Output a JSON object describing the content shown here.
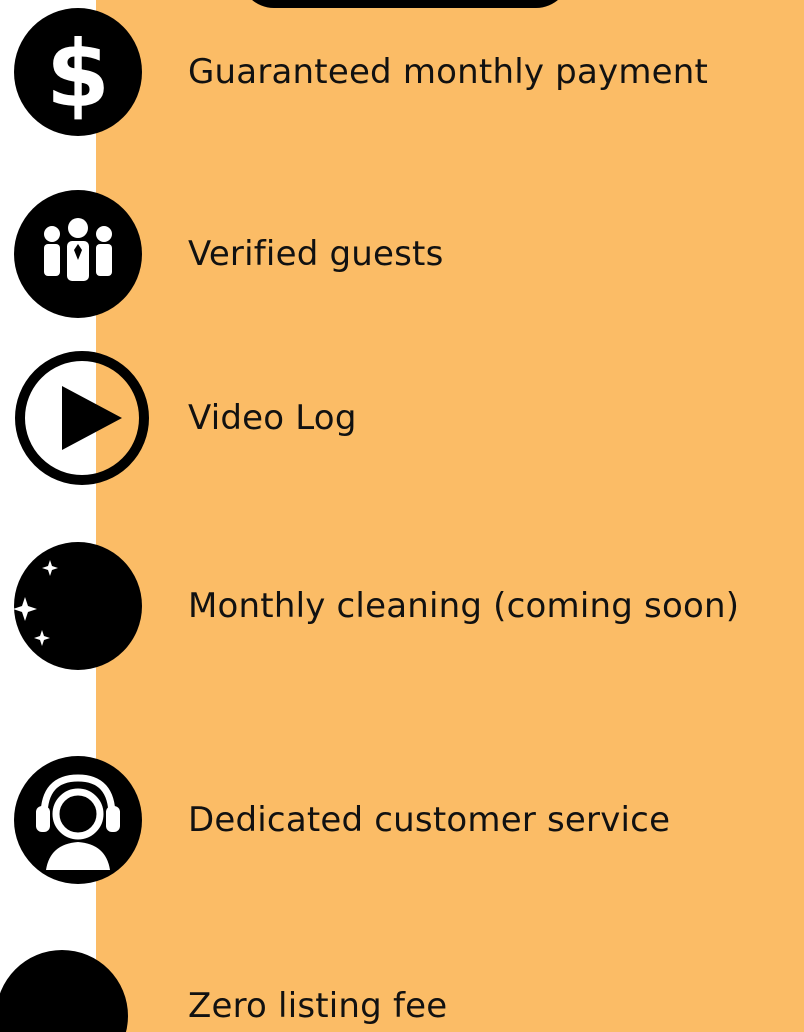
{
  "colors": {
    "background": "#FFFFFF",
    "panel": "#FBBC66",
    "icon": "#000000",
    "text": "#111111"
  },
  "features": [
    {
      "label": "Guaranteed monthly payment",
      "icon": "dollar-icon"
    },
    {
      "label": "Verified guests",
      "icon": "people-icon"
    },
    {
      "label": "Video Log",
      "icon": "play-icon"
    },
    {
      "label": "Monthly cleaning (coming soon)",
      "icon": "cleaning-hand-icon"
    },
    {
      "label": "Dedicated customer service",
      "icon": "customer-service-icon"
    },
    {
      "label": "Zero listing fee",
      "icon": "circle-icon"
    }
  ]
}
